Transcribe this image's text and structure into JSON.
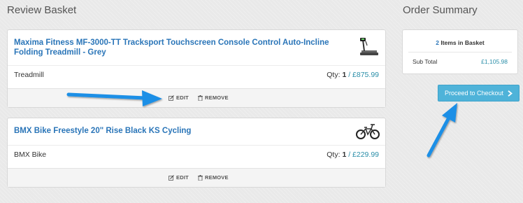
{
  "left_title": "Review Basket",
  "right_title": "Order Summary",
  "items": [
    {
      "name": "Maxima Fitness MF-3000-TT Tracksport Touchscreen Console Control Auto-Incline Folding Treadmill - Grey",
      "type": "Treadmill",
      "qty_label": "Qty:",
      "qty": "1",
      "price": "/ £875.99",
      "edit": "EDIT",
      "remove": "REMOVE",
      "icon": "treadmill-icon"
    },
    {
      "name": "BMX Bike Freestyle 20\" Rise Black KS Cycling",
      "type": "BMX Bike",
      "qty_label": "Qty:",
      "qty": "1",
      "price": "/ £229.99",
      "edit": "EDIT",
      "remove": "REMOVE",
      "icon": "bmx-bike-icon"
    }
  ],
  "summary": {
    "count": "2",
    "count_label": "Items in Basket",
    "subtotal_label": "Sub Total",
    "subtotal_value": "£1,105.98"
  },
  "checkout_label": "Proceed to Checkout",
  "colors": {
    "link_blue": "#2a75b8",
    "price_teal": "#2a8ea8",
    "checkout_bg": "#4fb3d9",
    "arrow_blue": "#1e8fe6"
  }
}
